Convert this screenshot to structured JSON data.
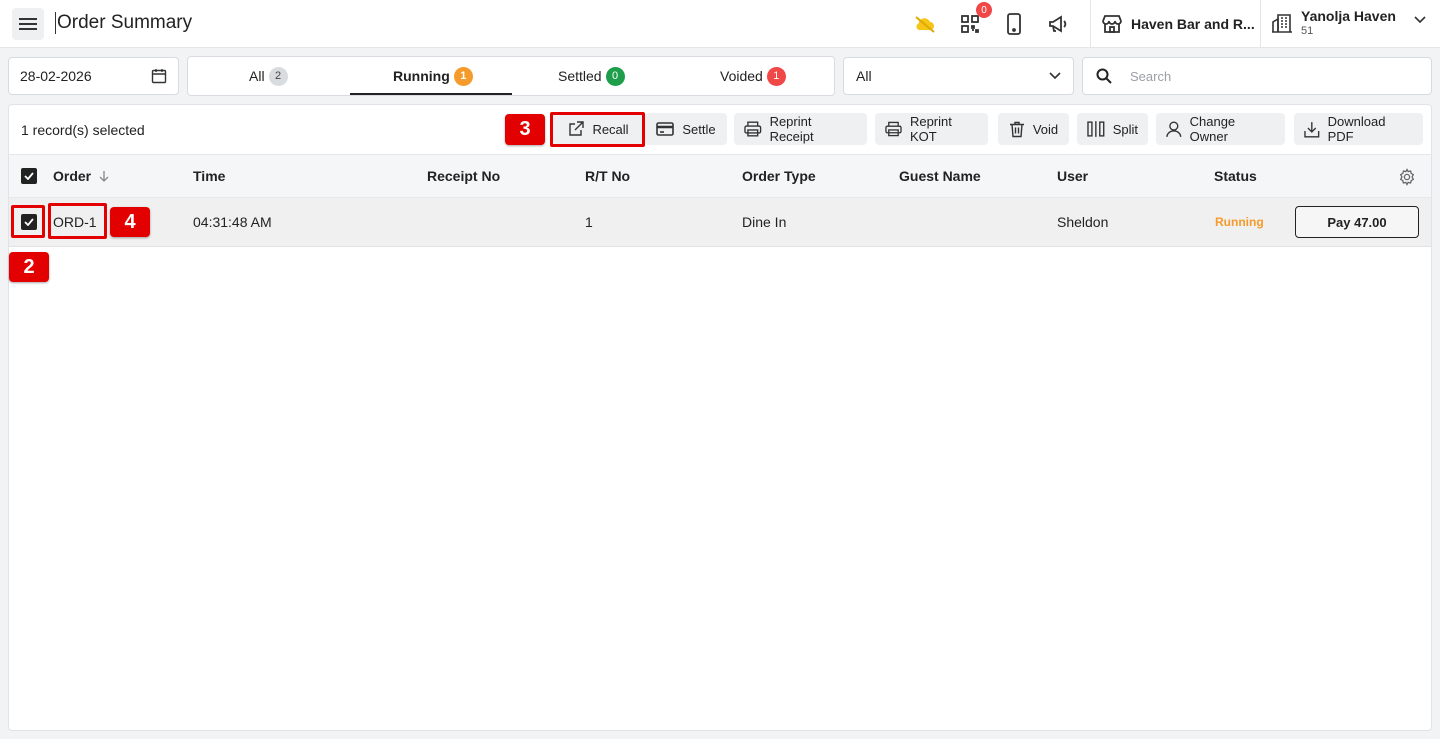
{
  "header": {
    "title": "Order Summary",
    "qr_badge_count": "0",
    "venue_name": "Haven Bar and R...",
    "property_name": "Yanolja Haven",
    "property_sub": "51"
  },
  "filters": {
    "date_value": "28-02-2026",
    "tabs": [
      {
        "label": "All",
        "count": "2",
        "badge_color": "#d9dcdf",
        "badge_text_color": "#444"
      },
      {
        "label": "Running",
        "count": "1",
        "badge_color": "#f59b2b",
        "badge_text_color": "#fff"
      },
      {
        "label": "Settled",
        "count": "0",
        "badge_color": "#1e9e4a",
        "badge_text_color": "#fff"
      },
      {
        "label": "Voided",
        "count": "1",
        "badge_color": "#f04747",
        "badge_text_color": "#fff"
      }
    ],
    "active_tab": "Running",
    "type_select_value": "All",
    "search_placeholder": "Search"
  },
  "toolbar": {
    "selected_text": "1 record(s) selected",
    "buttons": [
      {
        "label": "Recall",
        "icon": "external-link-icon"
      },
      {
        "label": "Settle",
        "icon": "card-icon"
      },
      {
        "label": "Reprint Receipt",
        "icon": "printer-icon"
      },
      {
        "label": "Reprint KOT",
        "icon": "printer-icon"
      },
      {
        "label": "Void",
        "icon": "trash-icon"
      },
      {
        "label": "Split",
        "icon": "split-icon"
      },
      {
        "label": "Change Owner",
        "icon": "user-icon"
      },
      {
        "label": "Download PDF",
        "icon": "download-icon"
      }
    ]
  },
  "table": {
    "columns": [
      "Order",
      "Time",
      "Receipt No",
      "R/T No",
      "Order Type",
      "Guest Name",
      "User",
      "Status"
    ],
    "rows": [
      {
        "order": "ORD-1",
        "time": "04:31:48 AM",
        "receipt_no": "",
        "rt_no": "1",
        "order_type": "Dine In",
        "guest_name": "",
        "user": "Sheldon",
        "status": "Running",
        "pay_label": "Pay 47.00"
      }
    ]
  },
  "annotations": [
    "2",
    "3",
    "4"
  ],
  "colors": {
    "accent_red": "#e30000",
    "running_orange": "#f59b2b",
    "settled_green": "#1e9e4a",
    "voided_red": "#f04747"
  }
}
